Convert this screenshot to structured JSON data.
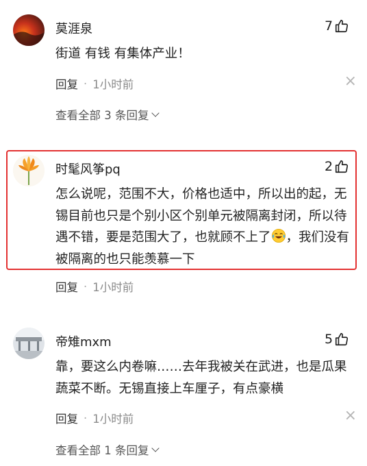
{
  "comments": [
    {
      "username": "莫涯泉",
      "likes": "7",
      "text": "街道 有钱 有集体产业！",
      "reply_label": "回复",
      "dot": "·",
      "time": "1小时前",
      "more": "×",
      "view_all_replies": "查看全部 3 条回复",
      "avatar_icon": "sunset-avatar"
    },
    {
      "username": "时髦风筝pq",
      "likes": "2",
      "text_part1": "怎么说呢，范围不大，价格也适中，所以出的起，无锡目前也只是个别小区个别单元被隔离封闭，所以待遇不错，要是范围大了，也就顾不上了",
      "text_part2": "，我们没有被隔离的也只能羡慕一下",
      "reply_label": "回复",
      "dot": "·",
      "time": "1小时前",
      "avatar_icon": "flower-avatar",
      "emoji_icon": "laughing-crying-emoji"
    },
    {
      "username": "帝雉mxm",
      "likes": "5",
      "text": "靠，要这么内卷嘛……去年我被关在武进，也是瓜果蔬菜不断。无锡直接上车厘子，有点豪横",
      "reply_label": "回复",
      "dot": "·",
      "time": "1小时前",
      "more": "×",
      "view_all_replies": "查看全部 1 条回复",
      "avatar_icon": "street-avatar"
    }
  ],
  "colors": {
    "highlight_border": "#e33030",
    "meta_text": "#8a8a8a"
  }
}
